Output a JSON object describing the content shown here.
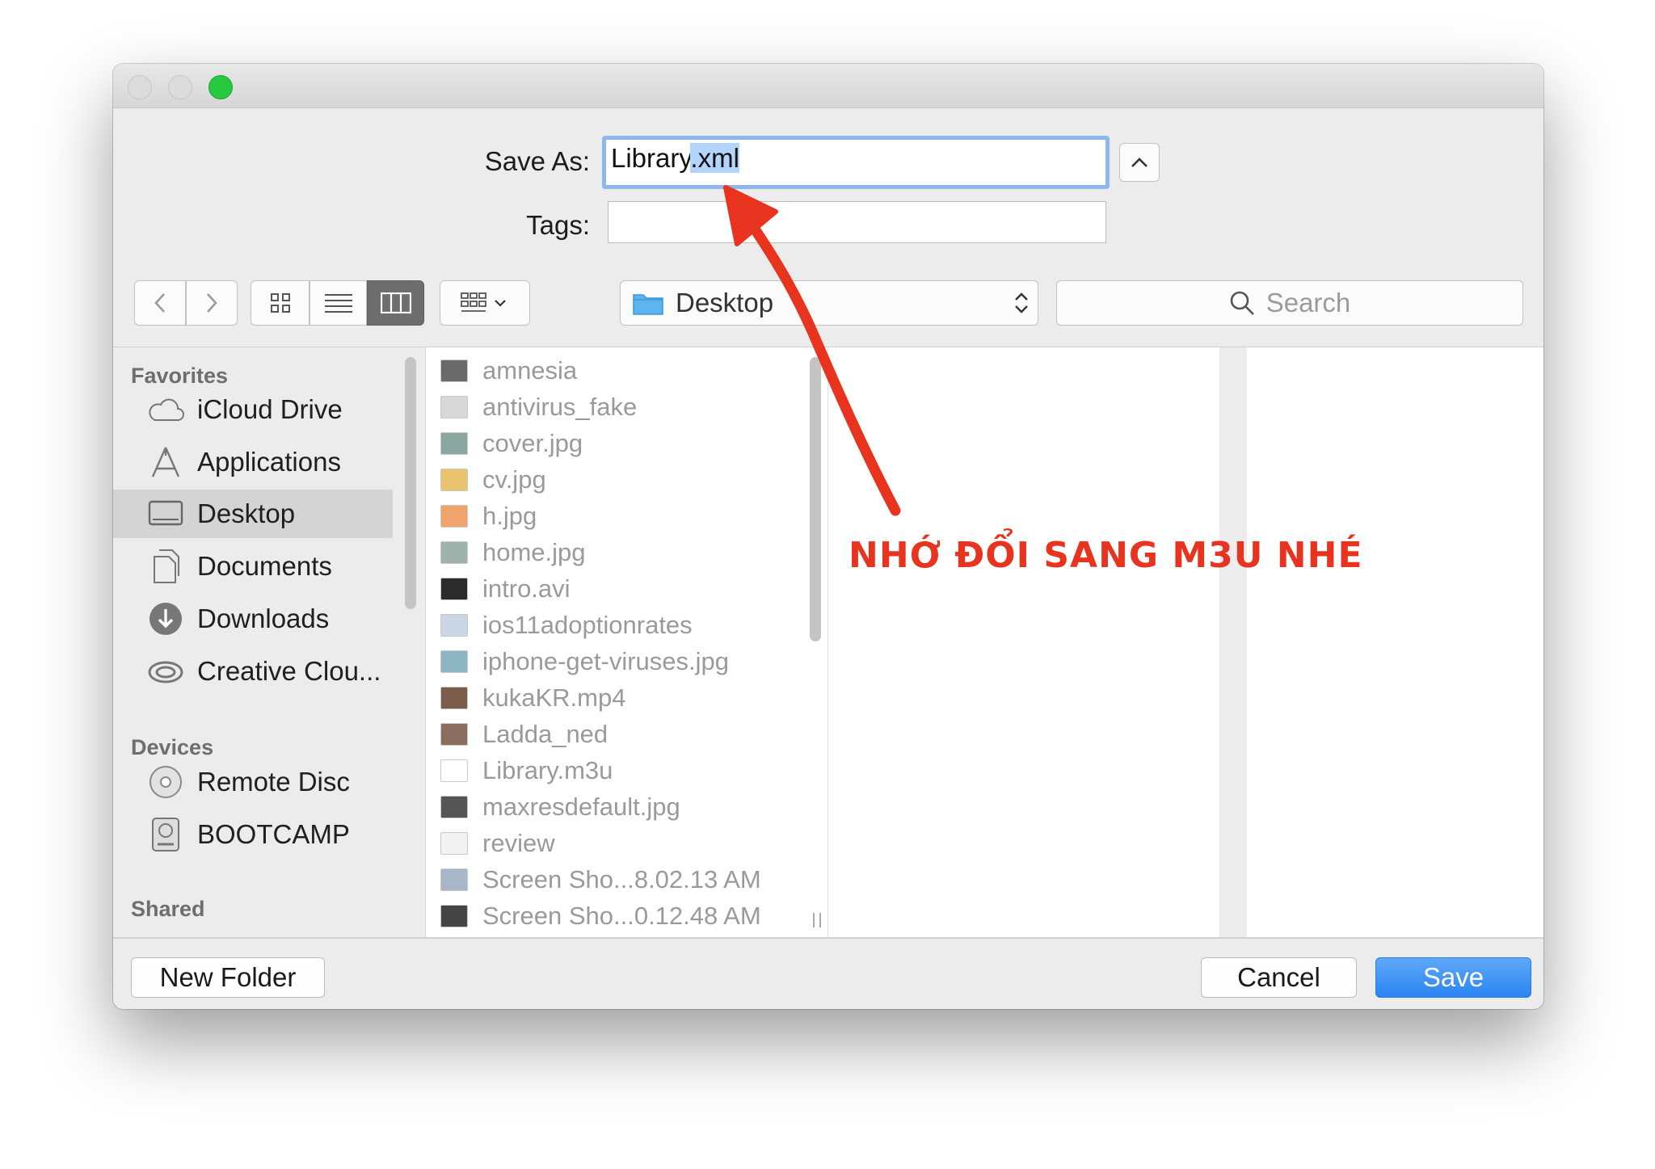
{
  "save_as": {
    "label": "Save As:",
    "value_base": "Library",
    "value_selected": ".xml",
    "tags_label": "Tags:",
    "tags_value": ""
  },
  "toolbar": {
    "location": "Desktop",
    "search_placeholder": "Search"
  },
  "sidebar": {
    "favorites_header": "Favorites",
    "favorites": [
      {
        "label": "iCloud Drive",
        "icon": "cloud-icon"
      },
      {
        "label": "Applications",
        "icon": "applications-icon"
      },
      {
        "label": "Desktop",
        "icon": "desktop-icon",
        "active": true
      },
      {
        "label": "Documents",
        "icon": "documents-icon"
      },
      {
        "label": "Downloads",
        "icon": "downloads-icon"
      },
      {
        "label": "Creative Clou...",
        "icon": "creative-cloud-icon"
      }
    ],
    "devices_header": "Devices",
    "devices": [
      {
        "label": "Remote Disc",
        "icon": "disc-icon"
      },
      {
        "label": "BOOTCAMP",
        "icon": "drive-icon"
      }
    ],
    "shared_header": "Shared"
  },
  "files": [
    "amnesia",
    "antivirus_fake",
    "cover.jpg",
    "cv.jpg",
    "h.jpg",
    "home.jpg",
    "intro.avi",
    "ios11adoptionrates",
    "iphone-get-viruses.jpg",
    "kukaKR.mp4",
    "Ladda_ned",
    "Library.m3u",
    "maxresdefault.jpg",
    "review",
    "Screen Sho...8.02.13 AM",
    "Screen Sho...0.12.48 AM"
  ],
  "buttons": {
    "new_folder": "New Folder",
    "cancel": "Cancel",
    "save": "Save"
  },
  "annotation": {
    "text": "NHỚ ĐỔI SANG M3U NHÉ",
    "color": "#e8331f"
  },
  "colors": {
    "accent": "#2b84f2",
    "selection": "#b3d4fd",
    "zoom": "#27c93f"
  }
}
